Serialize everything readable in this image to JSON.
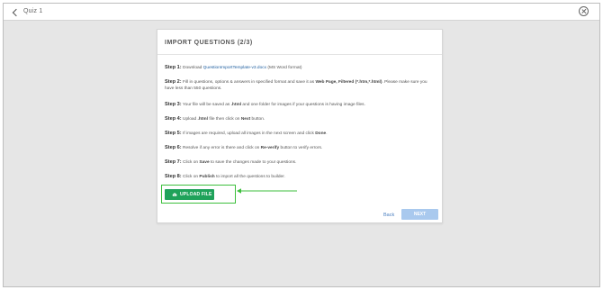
{
  "header": {
    "title": "Quiz 1",
    "back_icon": "chevron-left-icon",
    "close_icon": "close-circle-icon"
  },
  "card": {
    "title": "IMPORT QUESTIONS (2/3)",
    "steps": [
      {
        "label": "Step 1:",
        "parts": [
          "Download ",
          "QuestionImportTemplate-v3.docx",
          " (MS Word format)"
        ]
      },
      {
        "label": "Step 2:",
        "parts": [
          "Fill in questions, options & answers in specified format and save it as ",
          "Web Page, Filtered (*.htm,*.html)",
          ". Please make sure you have less than 550 questions."
        ]
      },
      {
        "label": "Step 3:",
        "parts": [
          "Your file will be saved as ",
          ".html",
          " and one folder for images if your questions is having image files."
        ]
      },
      {
        "label": "Step 4:",
        "parts": [
          "Upload ",
          ".html",
          " file then click on ",
          "Next",
          " button."
        ]
      },
      {
        "label": "Step 5:",
        "parts": [
          "If images are required, upload all images in the next screen and click ",
          "Done",
          "."
        ]
      },
      {
        "label": "Step 6:",
        "parts": [
          "Resolve if any error is there and click on ",
          "Re-verify",
          " button to verify errors."
        ]
      },
      {
        "label": "Step 7:",
        "parts": [
          "Click on ",
          "Save",
          " to save the changes made to your questions."
        ]
      },
      {
        "label": "Step 8:",
        "parts": [
          "Click on ",
          "Publish",
          " to import all the questions to builder."
        ]
      }
    ],
    "upload_label": "UPLOAD FILE",
    "upload_icon": "cloud-upload-icon",
    "back_label": "Back",
    "next_label": "NEXT"
  },
  "colors": {
    "upload_button": "#1fa25a",
    "highlight": "#3dbf3d",
    "next_button": "#a9c9ee",
    "link": "#1f5fa0"
  }
}
